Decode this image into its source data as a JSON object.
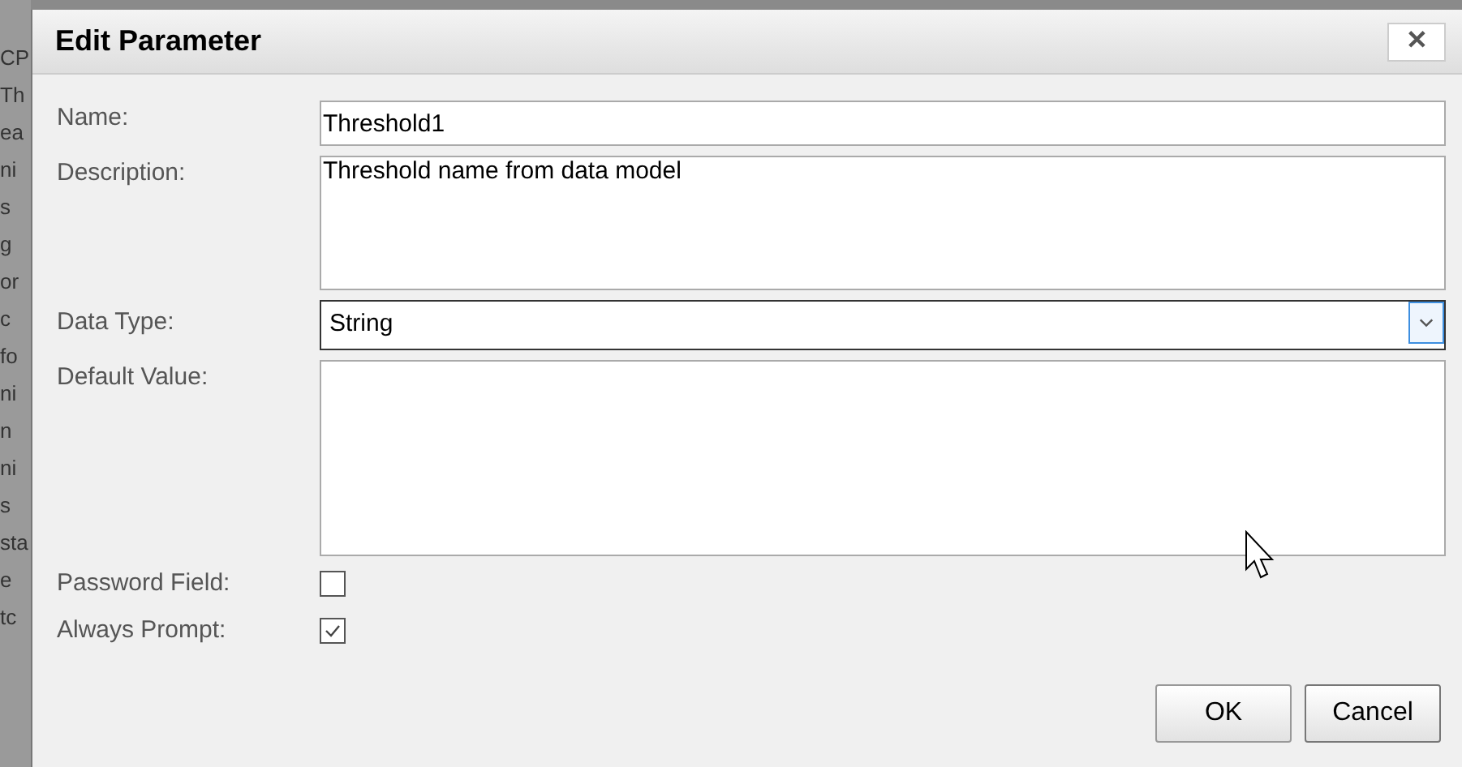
{
  "background_fragments": [
    "CP",
    "Th",
    "ea",
    "ni",
    "s",
    "g",
    "or",
    "c",
    "fo",
    "ni",
    "n",
    "ni",
    "s",
    "sta",
    "e",
    "tc"
  ],
  "dialog": {
    "title": "Edit Parameter",
    "close": "✕",
    "name": {
      "label": "Name:",
      "value": "Threshold1"
    },
    "description": {
      "label": "Description:",
      "value": "Threshold name from data model"
    },
    "data_type": {
      "label": "Data Type:",
      "value": "String"
    },
    "default_value": {
      "label": "Default Value:"
    },
    "checkboxes": [
      {
        "label": "Password Field:",
        "checked": false
      },
      {
        "label": "Always Prompt:",
        "checked": true
      }
    ],
    "buttons": [
      "OK",
      "Cancel"
    ]
  }
}
